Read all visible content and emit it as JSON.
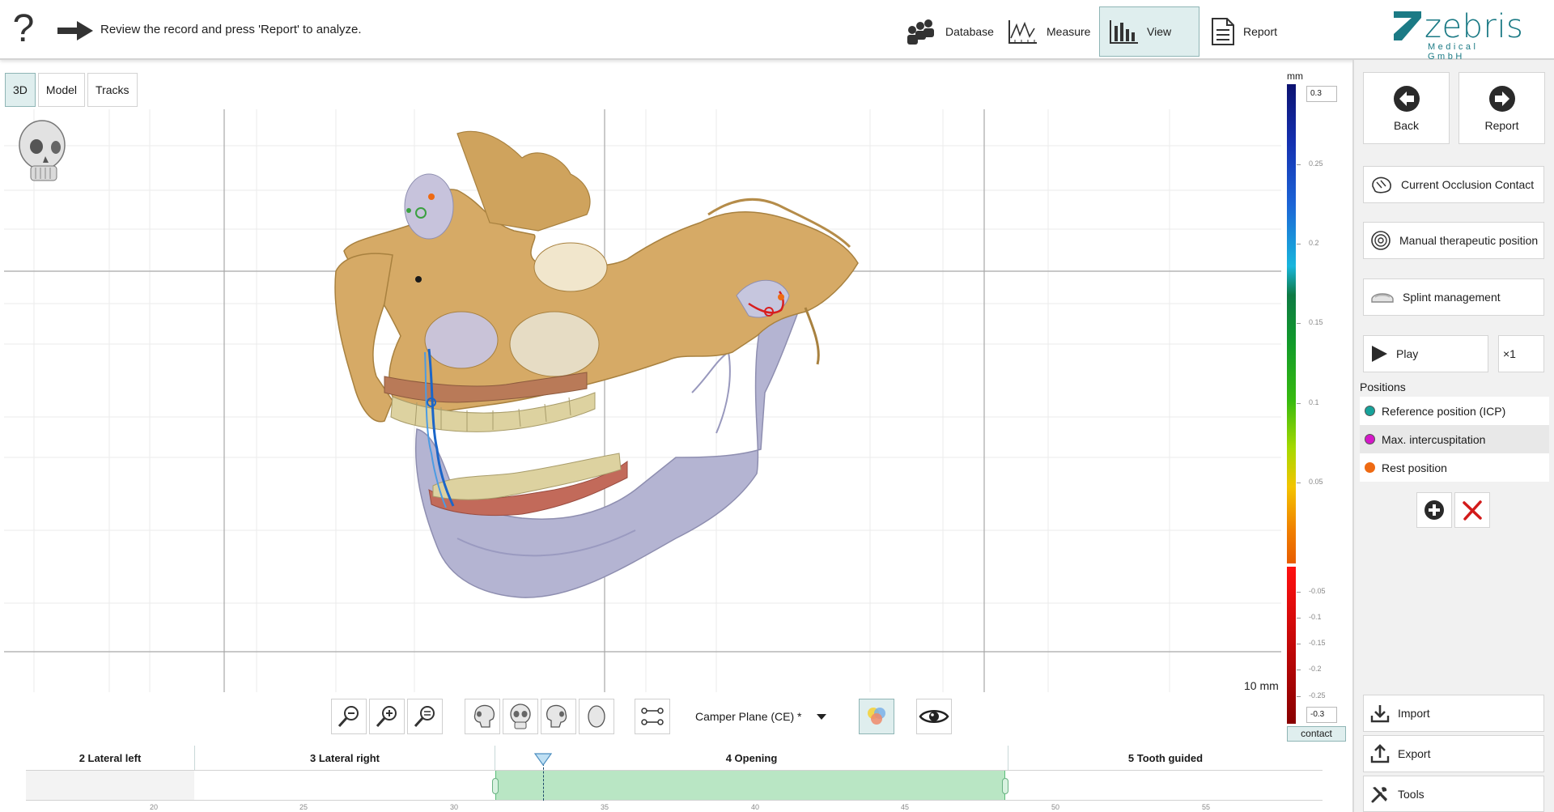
{
  "header": {
    "help_glyph": "?",
    "instruction": "Review the record and press 'Report' to analyze.",
    "nav": [
      {
        "label": "Database",
        "icon": "users-icon"
      },
      {
        "label": "Measure",
        "icon": "measure-chart-icon"
      },
      {
        "label": "View",
        "icon": "bar-chart-icon",
        "active": true
      },
      {
        "label": "Report",
        "icon": "document-icon"
      }
    ],
    "logo": {
      "name": "zebris",
      "sub": "Medical GmbH"
    }
  },
  "view_tabs": [
    {
      "label": "3D",
      "active": true
    },
    {
      "label": "Model"
    },
    {
      "label": "Tracks"
    }
  ],
  "viewport": {
    "scale_label": "10 mm"
  },
  "legend": {
    "unit": "mm",
    "top_value": "0.3",
    "bottom_value": "-0.3",
    "ticks_positive": [
      "0.25",
      "0.2",
      "0.15",
      "0.1",
      "0.05"
    ],
    "ticks_negative": [
      "-0.05",
      "-0.1",
      "-0.15",
      "-0.2",
      "-0.25"
    ],
    "contact_label": "contact"
  },
  "toolbar": {
    "tools": [
      "zoom-out-icon",
      "zoom-in-icon",
      "zoom-fit-icon",
      "skull-left-icon",
      "skull-front-icon",
      "skull-right-icon",
      "skull-top-icon",
      "connection-icon"
    ],
    "plane_select": "Camper Plane (CE) *",
    "color_tool": "color-overlay-icon",
    "visibility_tool": "eye-icon"
  },
  "timeline": {
    "segments": [
      "2 Lateral left",
      "3 Lateral right",
      "4 Opening",
      "5 Tooth guided"
    ],
    "ticks": [
      "20",
      "25",
      "30",
      "35",
      "40",
      "45",
      "50",
      "55"
    ],
    "selection_start": 31.5,
    "selection_end": 48.5,
    "cursor": 33.1
  },
  "right_panel": {
    "back_label": "Back",
    "report_label": "Report",
    "actions": [
      "Current Occlusion Contact",
      "Manual therapeutic position",
      "Splint management"
    ],
    "play_label": "Play",
    "speed_label": "×1",
    "positions_title": "Positions",
    "positions": [
      {
        "label": "Reference position (ICP)",
        "color": "#17a39b"
      },
      {
        "label": "Max. intercuspitation",
        "color": "#d417c8"
      },
      {
        "label": "Rest position",
        "color": "#ee6a13"
      }
    ],
    "import_label": "Import",
    "export_label": "Export",
    "tools_label": "Tools"
  },
  "colors": {
    "accent": "#dfeeee",
    "accent_border": "#8fb5b5",
    "bone": "#d6aa66",
    "jaw": "#b4b4d2",
    "timeline_selection": "#b9e6c4"
  }
}
